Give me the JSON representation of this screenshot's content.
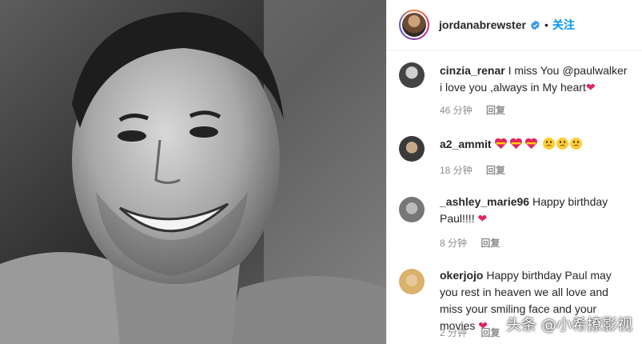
{
  "post": {
    "username": "jordanabrewster",
    "follow_label": "关注",
    "separator": "•"
  },
  "comments": [
    {
      "username": "cinzia_renar",
      "text": "I miss You @paulwalker i love you ,always in My heart",
      "trailing_emoji": "red-heart",
      "time": "46 分钟",
      "reply_label": "回复"
    },
    {
      "username": "a2_ammit",
      "emojis": [
        "heart-flag",
        "heart-flag",
        "heart-flag",
        "sad-face",
        "sad-face",
        "sad-face"
      ],
      "time": "18 分钟",
      "reply_label": "回复"
    },
    {
      "username": "_ashley_marie96",
      "text": "Happy birthday Paul!!!!",
      "trailing_emoji": "red-heart",
      "time": "8 分钟",
      "reply_label": "回复"
    },
    {
      "username": "okerjojo",
      "text": "Happy birthday Paul may you rest in heaven we all love and miss your smiling face and your movies",
      "trailing_emoji": "red-heart",
      "time": "2 分钟",
      "reply_label": "回复"
    }
  ],
  "watermark": "头条 @小希撩影视",
  "colors": {
    "link": "#0095f6",
    "verified": "#3897f0",
    "heart": "#e0245e",
    "meta": "#8e8e8e"
  }
}
